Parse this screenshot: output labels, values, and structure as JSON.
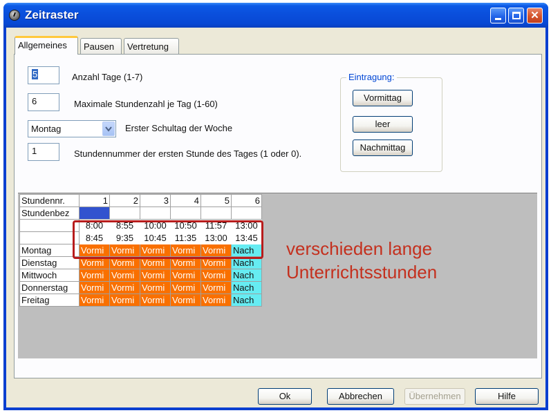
{
  "window": {
    "title": "Zeitraster"
  },
  "tabs": [
    {
      "label": "Allgemeines"
    },
    {
      "label": "Pausen"
    },
    {
      "label": "Vertretung"
    }
  ],
  "form": {
    "days": {
      "value": "5",
      "label": "Anzahl Tage (1-7)"
    },
    "max_lessons": {
      "value": "6",
      "label": "Maximale Stundenzahl je Tag (1-60)"
    },
    "first_day": {
      "value": "Montag",
      "label": "Erster Schultag der Woche"
    },
    "first_lesson": {
      "value": "1",
      "label": "Stundennummer der ersten Stunde des Tages (1 oder 0)."
    }
  },
  "entry_group": {
    "title": "Eintragung:",
    "morning_label": "Vormittag",
    "empty_label": "leer",
    "afternoon_label": "Nachmittag"
  },
  "timetable": {
    "header_label": "Stundennr.",
    "label_row": "Stundenbez",
    "periods": [
      "1",
      "2",
      "3",
      "4",
      "5",
      "6"
    ],
    "start_times": [
      "8:00",
      "8:55",
      "10:00",
      "10:50",
      "11:57",
      "13:00"
    ],
    "end_times": [
      "8:45",
      "9:35",
      "10:45",
      "11:35",
      "13:00",
      "13:45"
    ],
    "days": [
      {
        "name": "Montag",
        "cells": [
          "Vormi",
          "Vormi",
          "Vormi",
          "Vormi",
          "Vormi",
          "Nach"
        ]
      },
      {
        "name": "Dienstag",
        "cells": [
          "Vormi",
          "Vormi",
          "Vormi",
          "Vormi",
          "Vormi",
          "Nach"
        ]
      },
      {
        "name": "Mittwoch",
        "cells": [
          "Vormi",
          "Vormi",
          "Vormi",
          "Vormi",
          "Vormi",
          "Nach"
        ]
      },
      {
        "name": "Donnerstag",
        "cells": [
          "Vormi",
          "Vormi",
          "Vormi",
          "Vormi",
          "Vormi",
          "Nach"
        ]
      },
      {
        "name": "Freitag",
        "cells": [
          "Vormi",
          "Vormi",
          "Vormi",
          "Vormi",
          "Vormi",
          "Nach"
        ]
      }
    ]
  },
  "annotation": {
    "line1": "verschieden lange",
    "line2": "Unterrichtsstunden"
  },
  "buttons": {
    "ok": "Ok",
    "cancel": "Abbrechen",
    "apply": "Übernehmen",
    "help": "Hilfe"
  },
  "colors": {
    "morning": "#f97000",
    "afternoon": "#66ecf2",
    "selected": "#3253cf",
    "annotation": "#c4301e"
  }
}
